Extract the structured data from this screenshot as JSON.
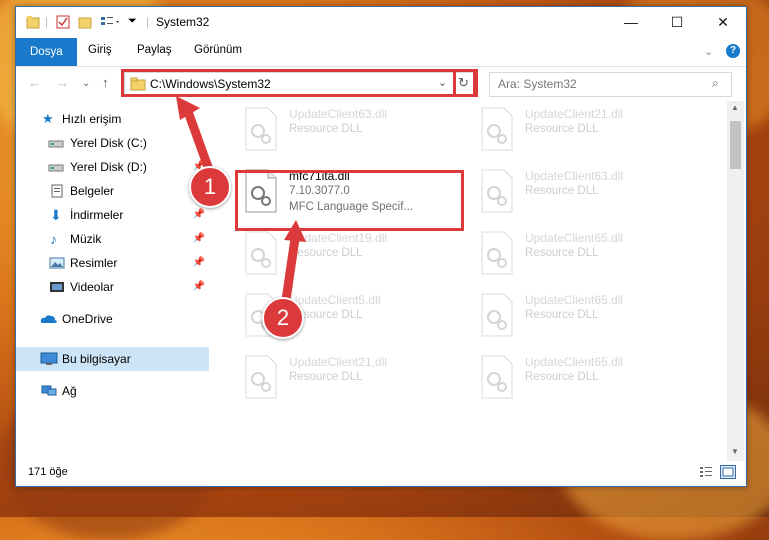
{
  "window": {
    "title": "System32",
    "controls": [
      "minimize",
      "maximize",
      "close"
    ]
  },
  "ribbon": {
    "tabs": [
      "Dosya",
      "Giriş",
      "Paylaş",
      "Görünüm"
    ],
    "active_tab": "Dosya",
    "help_icon": "?"
  },
  "address": {
    "path": "C:\\Windows\\System32",
    "search_placeholder": "Ara: System32"
  },
  "sidebar": {
    "items": [
      {
        "label": "Hızlı erişim",
        "icon": "star-icon",
        "pinned": false
      },
      {
        "label": "Yerel Disk (C:)",
        "icon": "drive-icon",
        "pinned": false
      },
      {
        "label": "Yerel Disk (D:)",
        "icon": "drive-icon",
        "pinned": true
      },
      {
        "label": "Belgeler",
        "icon": "document-icon",
        "pinned": true
      },
      {
        "label": "İndirmeler",
        "icon": "download-icon",
        "pinned": true
      },
      {
        "label": "Müzik",
        "icon": "music-icon",
        "pinned": true
      },
      {
        "label": "Resimler",
        "icon": "pictures-icon",
        "pinned": true
      },
      {
        "label": "Videolar",
        "icon": "video-icon",
        "pinned": true
      },
      {
        "label": "OneDrive",
        "icon": "cloud-icon",
        "pinned": false
      },
      {
        "label": "Bu bilgisayar",
        "icon": "computer-icon",
        "pinned": false
      },
      {
        "label": "Ağ",
        "icon": "network-icon",
        "pinned": false
      }
    ],
    "selected": "Bu bilgisayar"
  },
  "files": [
    {
      "name": "UpdateClient63.dll",
      "type": "Resource DLL"
    },
    {
      "name": "UpdateClient21.dll",
      "type": "Resource DLL"
    },
    {
      "name": "mfc71ita.dll",
      "version": "7.10.3077.0",
      "type": "MFC Language Specif..."
    },
    {
      "name": "UpdateClient63.dll",
      "type": "Resource DLL"
    },
    {
      "name": "UpdateClient19.dll",
      "type": "Resource DLL"
    },
    {
      "name": "UpdateClient65.dll",
      "type": "Resource DLL"
    },
    {
      "name": "UpdateClient5.dll",
      "type": "Resource DLL"
    },
    {
      "name": "UpdateClient65.dll",
      "type": "Resource DLL"
    },
    {
      "name": "UpdateClient21.dll",
      "type": "Resource DLL"
    },
    {
      "name": "UpdateClient65.dll",
      "type": "Resource DLL"
    }
  ],
  "status": {
    "count": "171 öğe"
  },
  "annotations": [
    "1",
    "2"
  ],
  "colors": {
    "accent": "#1979ca",
    "highlight": "#dc3a3a",
    "selected_bg": "#cce4f7"
  }
}
